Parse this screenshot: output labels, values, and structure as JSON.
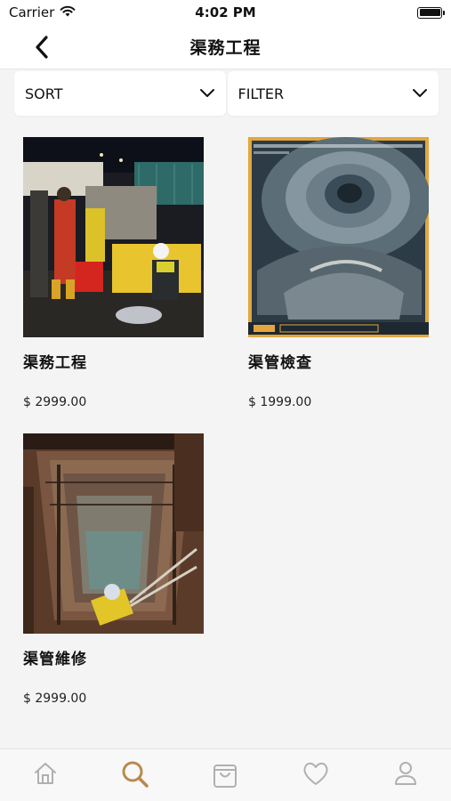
{
  "status_bar": {
    "carrier": "Carrier",
    "time": "4:02 PM",
    "icons": [
      "wifi-icon",
      "battery-icon"
    ]
  },
  "nav": {
    "title": "渠務工程",
    "back_icon": "chevron-left-icon"
  },
  "controls": {
    "sort_label": "SORT",
    "filter_label": "FILTER",
    "dropdown_icon": "chevron-down-icon"
  },
  "products": [
    {
      "name": "渠務工程",
      "price": "$ 2999.00",
      "image": "night-drainage-workers-photo"
    },
    {
      "name": "渠管檢查",
      "price": "$ 1999.00",
      "image": "pipe-cctv-inspection-photo"
    },
    {
      "name": "渠管維修",
      "price": "$ 2999.00",
      "image": "manhole-repair-photo"
    }
  ],
  "tab_bar": {
    "tabs": [
      {
        "name": "home",
        "icon": "home-icon",
        "active": false
      },
      {
        "name": "search",
        "icon": "search-icon",
        "active": true
      },
      {
        "name": "cart",
        "icon": "shopping-bag-icon",
        "active": false
      },
      {
        "name": "favorites",
        "icon": "heart-icon",
        "active": false
      },
      {
        "name": "profile",
        "icon": "user-icon",
        "active": false
      }
    ],
    "active_color": "#b98a4e",
    "inactive_color": "#b0b0b0"
  }
}
